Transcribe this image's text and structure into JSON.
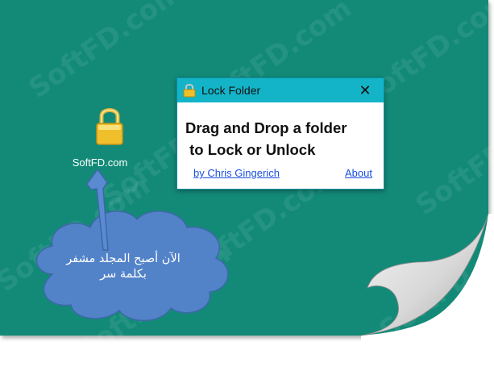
{
  "watermark_text": "SoftFD.com",
  "desktop_icon": {
    "label": "SoftFD.com",
    "icon": "padlock-icon"
  },
  "window": {
    "title": "Lock Folder",
    "close_label": "✕",
    "line1": "Drag and Drop a folder",
    "line2": " to Lock or Unlock",
    "author_link": "by Chris Gingerich",
    "about_link": "About"
  },
  "callout": {
    "line1": "الآن أصبح المجلد مشفر",
    "line2": "بكلمة سر"
  },
  "colors": {
    "desktop": "#138a78",
    "titlebar": "#14b4c8",
    "link": "#1a4fe0",
    "cloud": "#5283c8",
    "arrow": "#5a8ad0"
  }
}
